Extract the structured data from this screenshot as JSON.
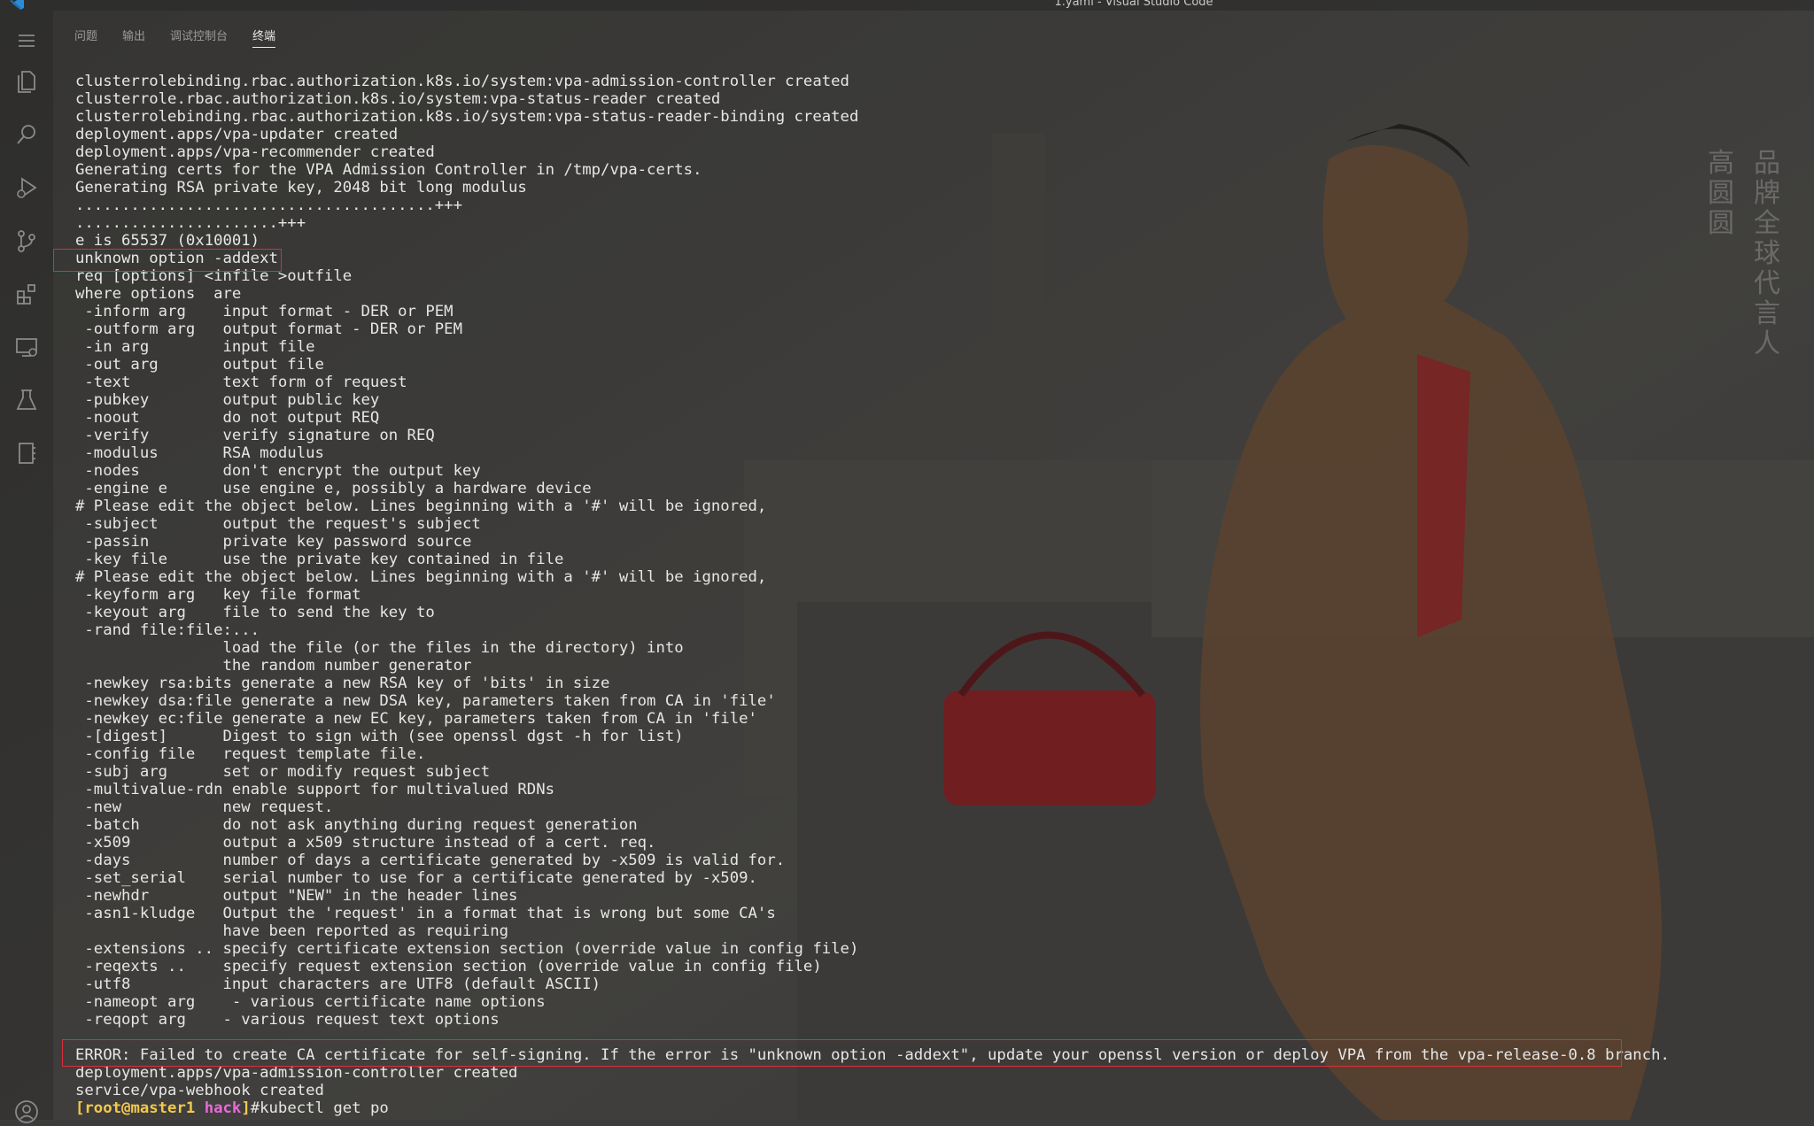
{
  "window": {
    "title": "1.yaml - Visual Studio Code"
  },
  "activity_bar": {
    "icons": [
      "menu-icon",
      "files-icon",
      "search-icon",
      "run-debug-icon",
      "source-control-icon",
      "extensions-icon",
      "remote-explorer-icon",
      "testing-icon",
      "notebook-icon",
      "account-icon"
    ]
  },
  "panel": {
    "tabs": [
      {
        "label": "问题",
        "active": false
      },
      {
        "label": "输出",
        "active": false
      },
      {
        "label": "调试控制台",
        "active": false
      },
      {
        "label": "终端",
        "active": true
      }
    ]
  },
  "terminal": {
    "lines": [
      "clusterrolebinding.rbac.authorization.k8s.io/system:vpa-admission-controller created",
      "clusterrole.rbac.authorization.k8s.io/system:vpa-status-reader created",
      "clusterrolebinding.rbac.authorization.k8s.io/system:vpa-status-reader-binding created",
      "deployment.apps/vpa-updater created",
      "deployment.apps/vpa-recommender created",
      "Generating certs for the VPA Admission Controller in /tmp/vpa-certs.",
      "Generating RSA private key, 2048 bit long modulus",
      ".......................................+++",
      "......................+++",
      "e is 65537 (0x10001)",
      "unknown option -addext",
      "req [options] <infile >outfile",
      "where options  are",
      " -inform arg    input format - DER or PEM",
      " -outform arg   output format - DER or PEM",
      " -in arg        input file",
      " -out arg       output file",
      " -text          text form of request",
      " -pubkey        output public key",
      " -noout         do not output REQ",
      " -verify        verify signature on REQ",
      " -modulus       RSA modulus",
      " -nodes         don't encrypt the output key",
      " -engine e      use engine e, possibly a hardware device",
      "# Please edit the object below. Lines beginning with a '#' will be ignored,",
      " -subject       output the request's subject",
      " -passin        private key password source",
      " -key file      use the private key contained in file",
      "# Please edit the object below. Lines beginning with a '#' will be ignored,",
      " -keyform arg   key file format",
      " -keyout arg    file to send the key to",
      " -rand file:file:...",
      "                load the file (or the files in the directory) into",
      "                the random number generator",
      " -newkey rsa:bits generate a new RSA key of 'bits' in size",
      " -newkey dsa:file generate a new DSA key, parameters taken from CA in 'file'",
      " -newkey ec:file generate a new EC key, parameters taken from CA in 'file'",
      " -[digest]      Digest to sign with (see openssl dgst -h for list)",
      " -config file   request template file.",
      " -subj arg      set or modify request subject",
      " -multivalue-rdn enable support for multivalued RDNs",
      " -new           new request.",
      " -batch         do not ask anything during request generation",
      " -x509          output a x509 structure instead of a cert. req.",
      " -days          number of days a certificate generated by -x509 is valid for.",
      " -set_serial    serial number to use for a certificate generated by -x509.",
      " -newhdr        output \"NEW\" in the header lines",
      " -asn1-kludge   Output the 'request' in a format that is wrong but some CA's",
      "                have been reported as requiring",
      " -extensions .. specify certificate extension section (override value in config file)",
      " -reqexts ..    specify request extension section (override value in config file)",
      " -utf8          input characters are UTF8 (default ASCII)",
      " -nameopt arg    - various certificate name options",
      " -reqopt arg    - various request text options",
      "",
      "ERROR: Failed to create CA certificate for self-signing. If the error is \"unknown option -addext\", update your openssl version or deploy VPA from the vpa-release-0.8 branch.",
      "deployment.apps/vpa-admission-controller created",
      "service/vpa-webhook created"
    ],
    "prompt": {
      "open": "[",
      "user": "root",
      "at": "@",
      "host": "master1",
      "space": " ",
      "dir": "hack",
      "close": "]",
      "hash": "#",
      "command": "kubectl get po"
    }
  },
  "watermark": {
    "col1": "品牌全球代言人",
    "col2": "高圆圆"
  },
  "colors": {
    "highlight_border": "#d8303b",
    "prompt_user": "#f2c94c",
    "prompt_dir": "#e66bd8",
    "terminal_text": "#e6e6e6"
  }
}
